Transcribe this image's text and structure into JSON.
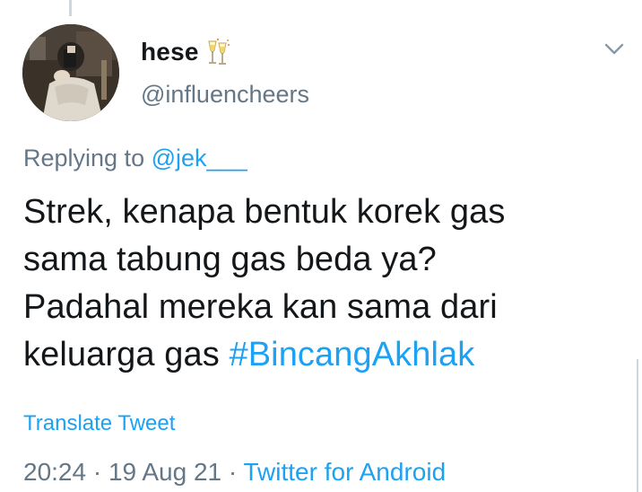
{
  "user": {
    "display_name": "hese",
    "badge_icon": "champagne-toast-icon",
    "handle": "@influencheers",
    "avatar_icon": "profile-photo-avatar"
  },
  "menu": {
    "icon": "chevron-down-icon"
  },
  "reply": {
    "prefix": "Replying to",
    "mention": "@jek___"
  },
  "tweet": {
    "lines": [
      "Strek, kenapa bentuk korek gas",
      "sama tabung gas beda ya?",
      "Padahal mereka kan sama dari",
      "keluarga gas"
    ],
    "hashtag": "#BincangAkhlak"
  },
  "actions": {
    "translate_label": "Translate Tweet"
  },
  "meta": {
    "time": "20:24",
    "separator1": " · ",
    "date": "19 Aug 21",
    "separator2": " · ",
    "source": "Twitter for Android"
  },
  "colors": {
    "link": "#1da1f2",
    "secondary_text": "#657786",
    "primary_text": "#14171a"
  }
}
